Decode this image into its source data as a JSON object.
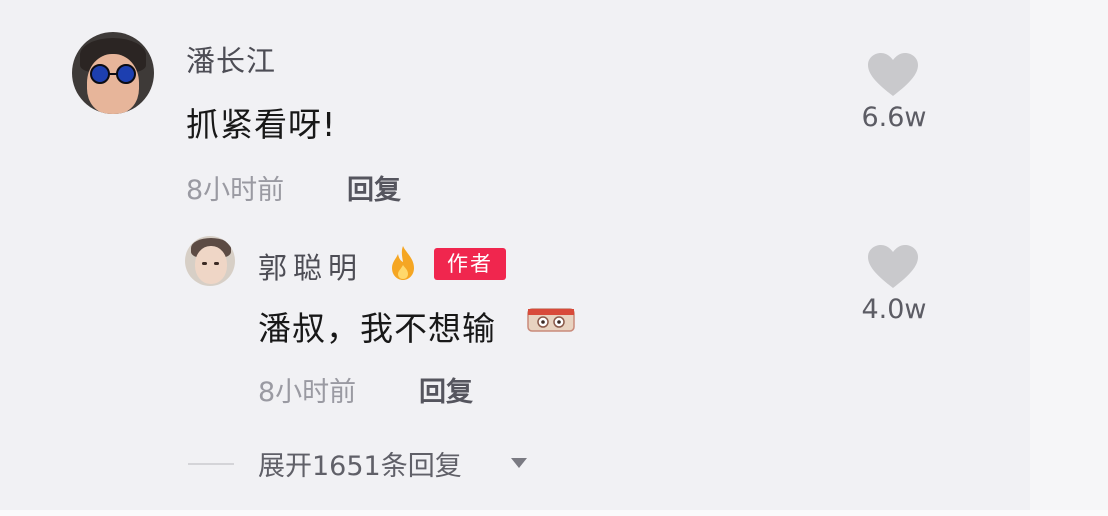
{
  "comments": [
    {
      "username": "潘长江",
      "text": "抓紧看呀!",
      "time": "8小时前",
      "reply_label": "回复",
      "like_count": "6.6w",
      "avatar_icon": "avatar-sunglasses"
    },
    {
      "username": "郭聪明",
      "badge_icon": "flame-icon",
      "author_badge": "作者",
      "text": "潘叔，我不想输",
      "text_emoji": "sticker-emoji",
      "time": "8小时前",
      "reply_label": "回复",
      "like_count": "4.0w",
      "avatar_icon": "avatar-portrait"
    }
  ],
  "expand_replies": {
    "label": "展开1651条回复",
    "icon": "triangle-down-icon"
  },
  "colors": {
    "author_badge_bg": "#f0264e",
    "like_icon": "#c9c9cc",
    "flame": "#f5a623"
  }
}
